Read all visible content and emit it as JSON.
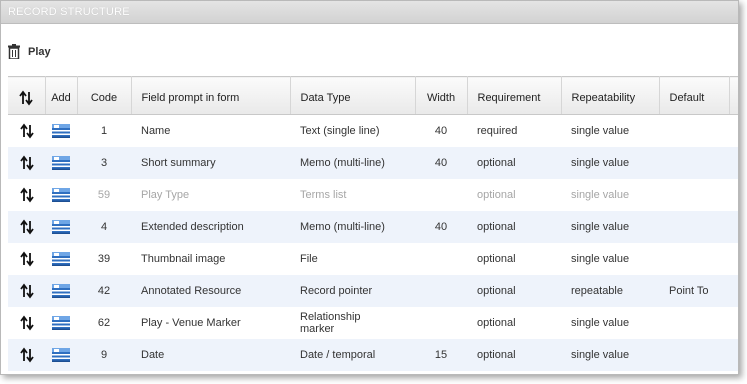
{
  "window": {
    "title": "RECORD STRUCTURE"
  },
  "toolbar": {
    "play_label": "Play"
  },
  "table": {
    "headers": {
      "add": "Add",
      "code": "Code",
      "prompt": "Field prompt in form",
      "datatype": "Data Type",
      "width": "Width",
      "requirement": "Requirement",
      "repeatability": "Repeatability",
      "default": "Default"
    },
    "rows": [
      {
        "code": "1",
        "prompt": "Name",
        "datatype": "Text (single line)",
        "width": "40",
        "requirement": "required",
        "repeatability": "single value",
        "default": ""
      },
      {
        "code": "3",
        "prompt": "Short summary",
        "datatype": "Memo (multi-line)",
        "width": "40",
        "requirement": "optional",
        "repeatability": "single value",
        "default": ""
      },
      {
        "code": "59",
        "prompt": "Play Type",
        "datatype": "Terms list",
        "width": "",
        "requirement": "optional",
        "repeatability": "single value",
        "default": ""
      },
      {
        "code": "4",
        "prompt": "Extended description",
        "datatype": "Memo (multi-line)",
        "width": "40",
        "requirement": "optional",
        "repeatability": "single value",
        "default": ""
      },
      {
        "code": "39",
        "prompt": "Thumbnail image",
        "datatype": "File",
        "width": "",
        "requirement": "optional",
        "repeatability": "single value",
        "default": ""
      },
      {
        "code": "42",
        "prompt": "Annotated Resource",
        "datatype": "Record pointer",
        "width": "",
        "requirement": "optional",
        "repeatability": "repeatable",
        "default": "Point To"
      },
      {
        "code": "62",
        "prompt": "Play - Venue Marker",
        "datatype": "Relationship marker",
        "width": "",
        "requirement": "optional",
        "repeatability": "single value",
        "default": ""
      },
      {
        "code": "9",
        "prompt": "Date",
        "datatype": "Date / temporal",
        "width": "15",
        "requirement": "optional",
        "repeatability": "single value",
        "default": ""
      }
    ]
  },
  "icons": {
    "toolbar": "trash-icon",
    "sort": "reorder-arrows-icon",
    "add": "add-field-icon"
  },
  "colors": {
    "alt_row": "#eef3fb",
    "flag_blue": "#2f6fc0",
    "disabled_text": "#a6a6a6"
  }
}
